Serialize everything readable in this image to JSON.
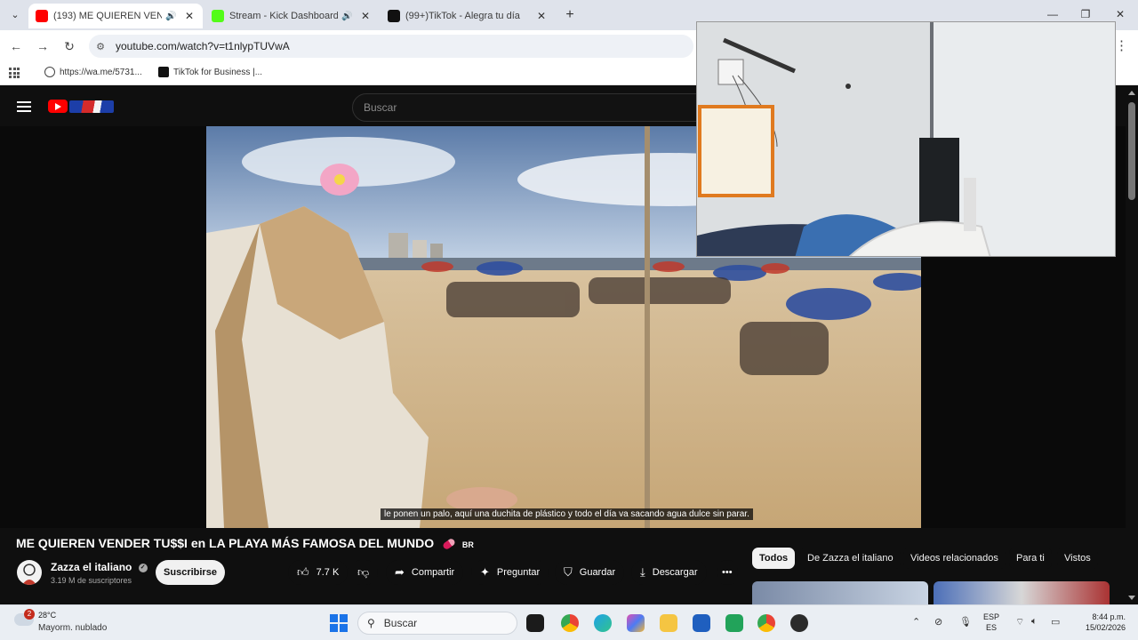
{
  "browser": {
    "tabs": [
      {
        "title": "(193) ME QUIEREN VENDER TU$$I en LA PLAYA MÁS FAMOSA DEL MUNDO - YouTube",
        "display": "(193) ME QUIEREN VENDEI",
        "active": true,
        "audio": true
      },
      {
        "title": "Stream - Kick Dashboard",
        "display": "Stream - Kick Dashboard",
        "active": false,
        "audio": true
      },
      {
        "title": "(99+) TikTok - Alegra tu día",
        "display": "(99+)TikTok - Alegra tu día",
        "active": false,
        "audio": false
      }
    ],
    "new_tab": "+",
    "url": "youtube.com/watch?v=t1nlypTUVwA",
    "bookmarks": [
      {
        "label": "https://wa.me/5731..."
      },
      {
        "label": "TikTok for Business |..."
      }
    ]
  },
  "youtube": {
    "search_placeholder": "Buscar",
    "subtitle": "le ponen un palo, aquí una duchita de plástico y todo el día va sacando agua dulce sin parar.",
    "video_title": "ME QUIEREN VENDER TU$$I en LA PLAYA MÁS FAMOSA DEL MUNDO",
    "title_tag": "BR",
    "channel_name": "Zazza el italiano",
    "subscribers": "3.19 M de suscriptores",
    "subscribe_label": "Suscribirse",
    "likes": "7.7 K",
    "share_label": "Compartir",
    "ask_label": "Preguntar",
    "save_label": "Guardar",
    "download_label": "Descargar",
    "more_label": "•••",
    "chips": [
      "Todos",
      "De Zazza el italiano",
      "Videos relacionados",
      "Para ti",
      "Vistos"
    ]
  },
  "taskbar": {
    "weather_temp": "28°C",
    "weather_condition": "Mayorm. nublado",
    "weather_badge": "2",
    "search_label": "Buscar",
    "language_line1": "ESP",
    "language_line2": "ES",
    "time": "8:44 p.m.",
    "date": "15/02/2026"
  }
}
